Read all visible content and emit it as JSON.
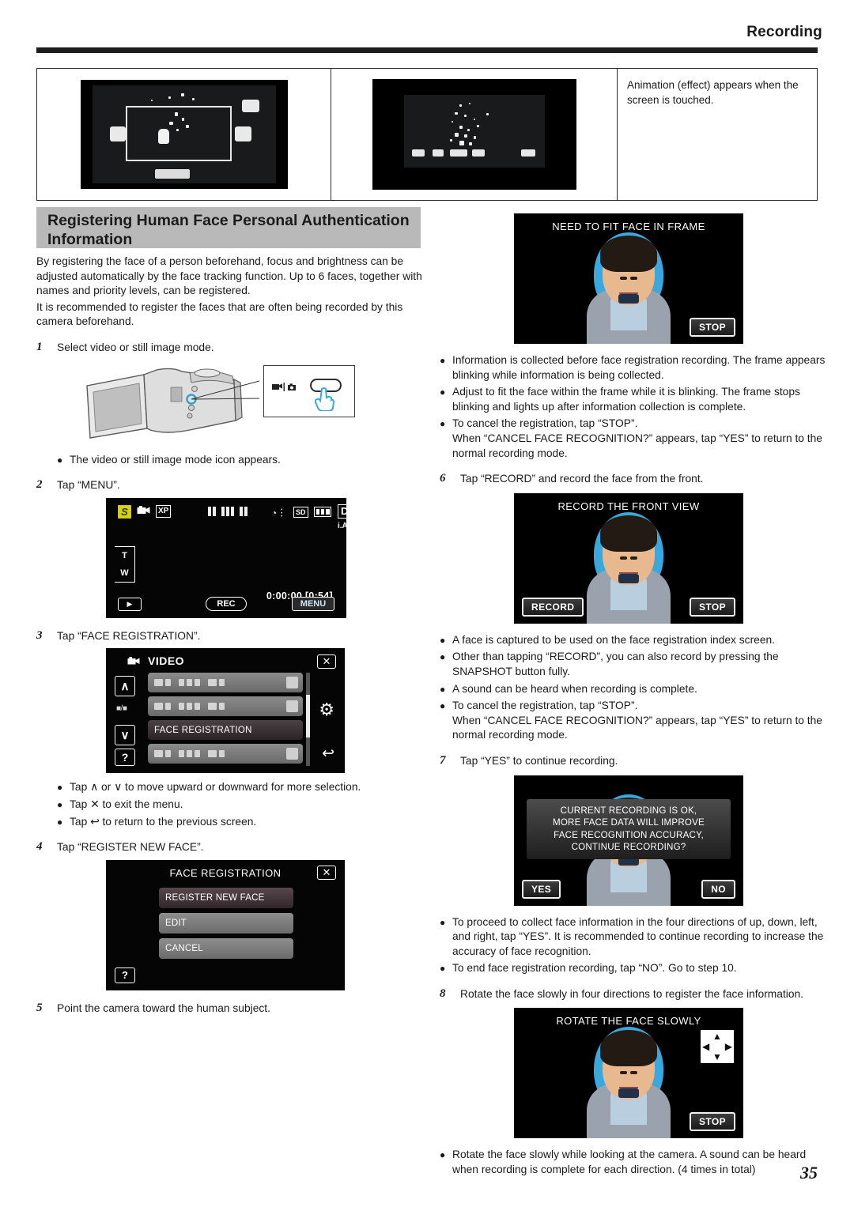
{
  "header": {
    "title": "Recording"
  },
  "top_table": {
    "cells": [
      {
        "type": "lcd_photo_animation",
        "caption": ""
      },
      {
        "type": "lcd_photo_sparkles",
        "caption": ""
      },
      {
        "type": "note",
        "caption": "Animation (effect) appears when the screen is touched."
      }
    ]
  },
  "section": {
    "title": "Registering Human Face Personal Authentication Information",
    "intro": [
      "By registering the face of a person beforehand, focus and brightness can be adjusted automatically by the face tracking function. Up to 6 faces, together with names and priority levels, can be registered.",
      "It is recommended to register the faces that are often being recorded by this camera beforehand."
    ]
  },
  "steps": {
    "s1": {
      "num": "1",
      "text": "Select video or still image mode."
    },
    "s1_bullets": [
      "The video or still image mode icon appears."
    ],
    "s2": {
      "num": "2",
      "text": "Tap “MENU”."
    },
    "s3": {
      "num": "3",
      "text": "Tap “FACE REGISTRATION”."
    },
    "s3_bullets": [
      "Tap ∧ or ∨ to move upward or downward for more selection.",
      "Tap ✕ to exit the menu.",
      "Tap ↩ to return to the previous screen."
    ],
    "s4": {
      "num": "4",
      "text": "Tap “REGISTER NEW FACE”."
    },
    "s5": {
      "num": "5",
      "text": "Point the camera toward the human subject."
    },
    "s5_bullets": [
      "Information is collected before face registration recording. The frame appears blinking while information is being collected.",
      "Adjust to fit the face within the frame while it is blinking. The frame stops blinking and lights up after information collection is complete.",
      "To cancel the registration, tap “STOP”.\nWhen “CANCEL FACE RECOGNITION?” appears, tap “YES” to return to the normal recording mode."
    ],
    "s6": {
      "num": "6",
      "text": "Tap “RECORD” and record the face from the front."
    },
    "s6_bullets": [
      "A face is captured to be used on the face registration index screen.",
      "Other than tapping “RECORD”, you can also record by pressing the SNAPSHOT button fully.",
      "A sound can be heard when recording is complete.",
      "To cancel the registration, tap “STOP”.\nWhen “CANCEL FACE RECOGNITION?” appears, tap “YES” to return to the normal recording mode."
    ],
    "s7": {
      "num": "7",
      "text": "Tap “YES” to continue recording."
    },
    "s7_bullets": [
      "To proceed to collect face information in the four directions of up, down, left, and right, tap “YES”. It is recommended to continue recording to increase the accuracy of face recognition.",
      "To end face registration recording, tap “NO”. Go to step 10."
    ],
    "s8": {
      "num": "8",
      "text": "Rotate the face slowly in four directions to register the face information."
    },
    "s8_bullets": [
      "Rotate the face slowly while looking at the camera. A sound can be heard when recording is complete for each direction. (4 times in total)"
    ]
  },
  "camera_illustration": {
    "mode_icons": "🎥 | 📷",
    "button_label": ""
  },
  "lcd_recording": {
    "badge_s": "S",
    "quality": "XP",
    "sd": "SD",
    "d_mark": "D",
    "ia_label": "i.A.",
    "zoom_t": "T",
    "zoom_w": "W",
    "timecode": "0:00:00  [0:54]",
    "play_icon": "▶",
    "rec_button": "REC",
    "menu_button": "MENU"
  },
  "lcd_menu": {
    "title": "VIDEO",
    "close": "✕",
    "up": "∧",
    "down": "∨",
    "ratio": "■/■",
    "help": "?",
    "gear": "⚙",
    "back": "↩",
    "items": [
      {
        "label": "",
        "selected": false
      },
      {
        "label": "",
        "selected": false
      },
      {
        "label": "FACE REGISTRATION",
        "selected": true
      },
      {
        "label": "",
        "selected": false
      }
    ]
  },
  "lcd_face_registration": {
    "title": "FACE REGISTRATION",
    "close": "✕",
    "help": "?",
    "items": [
      {
        "label": "REGISTER NEW FACE",
        "selected": true
      },
      {
        "label": "EDIT",
        "selected": false
      },
      {
        "label": "CANCEL",
        "selected": false
      }
    ]
  },
  "face_screens": {
    "fit_frame": {
      "title": "NEED TO FIT FACE IN FRAME",
      "stop": "STOP"
    },
    "front_view": {
      "title": "RECORD THE FRONT VIEW",
      "record": "RECORD",
      "stop": "STOP"
    },
    "continue_dialog": {
      "lines": [
        "CURRENT RECORDING IS OK,",
        "MORE FACE DATA WILL IMPROVE",
        "FACE RECOGNITION ACCURACY,",
        "CONTINUE RECORDING?"
      ],
      "yes": "YES",
      "no": "NO"
    },
    "rotate": {
      "title": "ROTATE THE FACE SLOWLY",
      "stop": "STOP",
      "arrow_up": "▲",
      "arrow_down": "▼",
      "arrow_left": "◀",
      "arrow_right": "▶"
    }
  },
  "footer": {
    "page_number": "35"
  }
}
